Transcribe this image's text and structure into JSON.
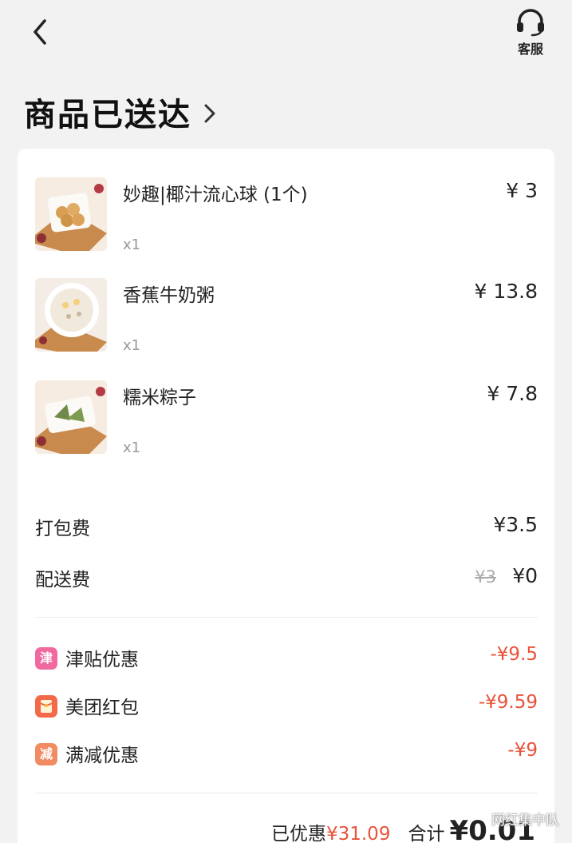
{
  "header": {
    "back_icon": "chevron-left-icon",
    "service_icon": "headset-icon",
    "service_label": "客服"
  },
  "status": {
    "title": "商品已送达",
    "chevron_icon": "chevron-right-icon"
  },
  "items": [
    {
      "name": "妙趣|椰汁流心球 (1个)",
      "qty": "x1",
      "price": "¥ 3",
      "image": "coconut-balls-image"
    },
    {
      "name": "香蕉牛奶粥",
      "qty": "x1",
      "price": "¥ 13.8",
      "image": "banana-milk-porridge-image"
    },
    {
      "name": "糯米粽子",
      "qty": "x1",
      "price": "¥ 7.8",
      "image": "rice-dumpling-image"
    }
  ],
  "fees": {
    "packing": {
      "label": "打包费",
      "value": "¥3.5"
    },
    "delivery": {
      "label": "配送费",
      "original": "¥3",
      "value": "¥0"
    }
  },
  "discounts": [
    {
      "badge": "津",
      "label": "津贴优惠",
      "value": "-¥9.5",
      "color": "#f06aa0"
    },
    {
      "badge": "",
      "label": "美团红包",
      "value": "-¥9.59",
      "color": "#f36a4a"
    },
    {
      "badge": "减",
      "label": "满减优惠",
      "value": "-¥9",
      "color": "#f08b62"
    }
  ],
  "summary": {
    "saved_label": "已优惠",
    "saved_value": "¥31.09",
    "total_label": "合计",
    "total_value": "¥0.01"
  },
  "watermark": "网红集中队",
  "colors": {
    "discount_red": "#e8533a",
    "background": "#f2f2f2"
  }
}
